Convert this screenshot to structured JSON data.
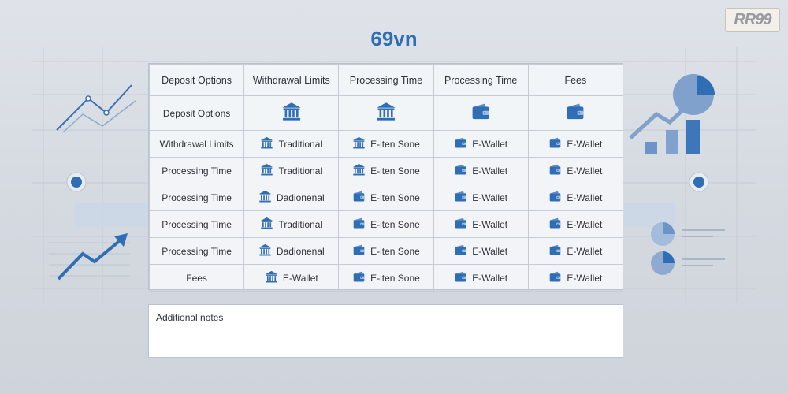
{
  "title": "69vn",
  "logo_text": "RR99",
  "colors": {
    "accent": "#2f6db5",
    "icon": "#2f6db5"
  },
  "table": {
    "headers": [
      "Deposit Options",
      "Withdrawal Limits",
      "Processing Time",
      "Processing Time",
      "Fees"
    ],
    "icon_row": {
      "label": "Deposit Options",
      "icons": [
        "bank-icon",
        "bank-icon",
        "wallet-icon",
        "wallet-icon"
      ]
    },
    "rows": [
      {
        "label": "Withdrawal Limits",
        "cells": [
          {
            "icon": "bank-icon",
            "text": "Traditional"
          },
          {
            "icon": "bank-icon",
            "text": "E-iten Sone"
          },
          {
            "icon": "wallet-icon",
            "text": "E-Wallet"
          },
          {
            "icon": "wallet-icon",
            "text": "E-Wallet"
          }
        ]
      },
      {
        "label": "Processing Time",
        "cells": [
          {
            "icon": "bank-icon",
            "text": "Traditional"
          },
          {
            "icon": "bank-icon",
            "text": "E-iten Sone"
          },
          {
            "icon": "wallet-icon",
            "text": "E-Wallet"
          },
          {
            "icon": "wallet-icon",
            "text": "E-Wallet"
          }
        ]
      },
      {
        "label": "Processing Time",
        "cells": [
          {
            "icon": "bank-icon",
            "text": "Dadionenal"
          },
          {
            "icon": "wallet-icon",
            "text": "E-iten Sone"
          },
          {
            "icon": "wallet-icon",
            "text": "E-Wallet"
          },
          {
            "icon": "wallet-icon",
            "text": "E-Wallet"
          }
        ]
      },
      {
        "label": "Processing Time",
        "cells": [
          {
            "icon": "bank-icon",
            "text": "Traditional"
          },
          {
            "icon": "wallet-icon",
            "text": "E-iten Sone"
          },
          {
            "icon": "wallet-icon",
            "text": "E-Wallet"
          },
          {
            "icon": "wallet-icon",
            "text": "E-Wallet"
          }
        ]
      },
      {
        "label": "Processing Time",
        "cells": [
          {
            "icon": "bank-icon",
            "text": "Dadionenal"
          },
          {
            "icon": "wallet-icon",
            "text": "E-iten Sone"
          },
          {
            "icon": "wallet-icon",
            "text": "E-Wallet"
          },
          {
            "icon": "wallet-icon",
            "text": "E-Wallet"
          }
        ]
      },
      {
        "label": "Fees",
        "cells": [
          {
            "icon": "bank-icon",
            "text": "E-Wallet"
          },
          {
            "icon": "wallet-icon",
            "text": "E-iten Sone"
          },
          {
            "icon": "wallet-icon",
            "text": "E-Wallet"
          },
          {
            "icon": "wallet-icon",
            "text": "E-Wallet"
          }
        ]
      }
    ]
  },
  "notes": {
    "label": "Additional notes"
  }
}
